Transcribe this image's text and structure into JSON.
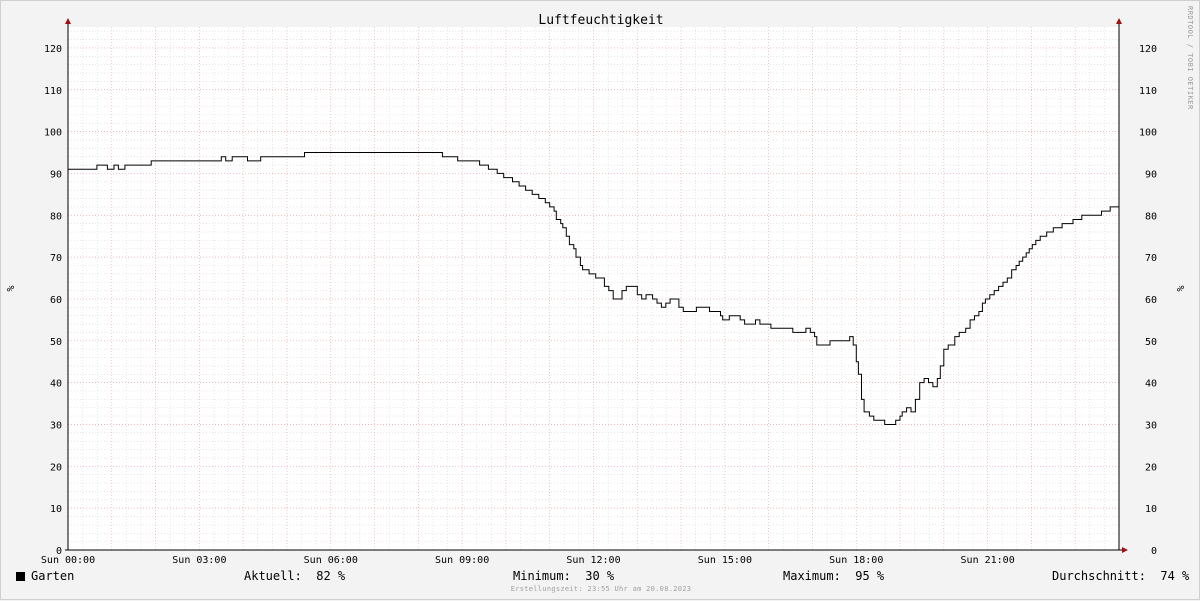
{
  "chart_data": {
    "type": "line",
    "title": "Luftfeuchtigkeit",
    "ylabel": "%",
    "y_right_label": "%",
    "watermark": "RRDTOOL / TOBI OETIKER",
    "ylim": [
      0,
      125
    ],
    "xlim": [
      0,
      24
    ],
    "yticks": [
      0,
      10,
      20,
      30,
      40,
      50,
      60,
      70,
      80,
      90,
      100,
      110,
      120
    ],
    "xticks": [
      {
        "x": 0,
        "label": "Sun 00:00"
      },
      {
        "x": 3,
        "label": "Sun 03:00"
      },
      {
        "x": 6,
        "label": "Sun 06:00"
      },
      {
        "x": 9,
        "label": "Sun 09:00"
      },
      {
        "x": 12,
        "label": "Sun 12:00"
      },
      {
        "x": 15,
        "label": "Sun 15:00"
      },
      {
        "x": 18,
        "label": "Sun 18:00"
      },
      {
        "x": 21,
        "label": "Sun 21:00"
      }
    ],
    "grid": true,
    "series": [
      {
        "name": "Garten",
        "color": "#000000",
        "step": true,
        "points": [
          [
            0.0,
            91
          ],
          [
            0.66,
            92
          ],
          [
            0.9,
            91
          ],
          [
            1.05,
            92
          ],
          [
            1.15,
            91
          ],
          [
            1.3,
            92
          ],
          [
            1.9,
            93
          ],
          [
            3.5,
            94
          ],
          [
            3.6,
            93
          ],
          [
            3.75,
            94
          ],
          [
            4.1,
            93
          ],
          [
            4.4,
            94
          ],
          [
            5.4,
            95
          ],
          [
            8.55,
            94
          ],
          [
            8.9,
            93
          ],
          [
            9.4,
            92
          ],
          [
            9.6,
            91
          ],
          [
            9.8,
            90
          ],
          [
            9.95,
            89
          ],
          [
            10.15,
            88
          ],
          [
            10.3,
            87
          ],
          [
            10.45,
            86
          ],
          [
            10.6,
            85
          ],
          [
            10.75,
            84
          ],
          [
            10.9,
            83
          ],
          [
            11.0,
            82
          ],
          [
            11.1,
            81
          ],
          [
            11.15,
            79
          ],
          [
            11.25,
            78
          ],
          [
            11.3,
            77
          ],
          [
            11.38,
            75
          ],
          [
            11.45,
            73
          ],
          [
            11.55,
            72
          ],
          [
            11.6,
            70
          ],
          [
            11.7,
            68
          ],
          [
            11.75,
            67
          ],
          [
            11.9,
            66
          ],
          [
            12.05,
            65
          ],
          [
            12.25,
            63
          ],
          [
            12.35,
            62
          ],
          [
            12.45,
            60
          ],
          [
            12.65,
            62
          ],
          [
            12.75,
            63
          ],
          [
            13.0,
            61
          ],
          [
            13.1,
            60
          ],
          [
            13.2,
            61
          ],
          [
            13.35,
            60
          ],
          [
            13.45,
            59
          ],
          [
            13.55,
            58
          ],
          [
            13.65,
            59
          ],
          [
            13.75,
            60
          ],
          [
            13.95,
            58
          ],
          [
            14.05,
            57
          ],
          [
            14.35,
            58
          ],
          [
            14.65,
            57
          ],
          [
            14.9,
            56
          ],
          [
            14.95,
            55
          ],
          [
            15.1,
            56
          ],
          [
            15.35,
            55
          ],
          [
            15.45,
            54
          ],
          [
            15.7,
            55
          ],
          [
            15.8,
            54
          ],
          [
            16.05,
            53
          ],
          [
            16.55,
            52
          ],
          [
            16.85,
            53
          ],
          [
            16.95,
            52
          ],
          [
            17.05,
            51
          ],
          [
            17.1,
            49
          ],
          [
            17.4,
            50
          ],
          [
            17.85,
            51
          ],
          [
            17.93,
            49
          ],
          [
            18.0,
            45
          ],
          [
            18.05,
            42
          ],
          [
            18.12,
            36
          ],
          [
            18.18,
            33
          ],
          [
            18.3,
            32
          ],
          [
            18.4,
            31
          ],
          [
            18.65,
            30
          ],
          [
            18.9,
            31
          ],
          [
            19.0,
            32
          ],
          [
            19.05,
            33
          ],
          [
            19.15,
            34
          ],
          [
            19.25,
            33
          ],
          [
            19.35,
            36
          ],
          [
            19.45,
            40
          ],
          [
            19.55,
            41
          ],
          [
            19.65,
            40
          ],
          [
            19.75,
            39
          ],
          [
            19.85,
            41
          ],
          [
            19.92,
            44
          ],
          [
            20.0,
            48
          ],
          [
            20.1,
            49
          ],
          [
            20.25,
            51
          ],
          [
            20.35,
            52
          ],
          [
            20.5,
            53
          ],
          [
            20.6,
            55
          ],
          [
            20.7,
            56
          ],
          [
            20.8,
            57
          ],
          [
            20.88,
            59
          ],
          [
            20.95,
            60
          ],
          [
            21.05,
            61
          ],
          [
            21.15,
            62
          ],
          [
            21.25,
            63
          ],
          [
            21.35,
            64
          ],
          [
            21.45,
            65
          ],
          [
            21.55,
            67
          ],
          [
            21.65,
            68
          ],
          [
            21.72,
            69
          ],
          [
            21.8,
            70
          ],
          [
            21.88,
            71
          ],
          [
            21.95,
            72
          ],
          [
            22.02,
            73
          ],
          [
            22.1,
            74
          ],
          [
            22.2,
            75
          ],
          [
            22.35,
            76
          ],
          [
            22.5,
            77
          ],
          [
            22.7,
            78
          ],
          [
            22.95,
            79
          ],
          [
            23.15,
            80
          ],
          [
            23.6,
            81
          ],
          [
            23.8,
            82
          ],
          [
            24.0,
            82
          ]
        ]
      }
    ]
  },
  "legend": {
    "series_name": "Garten",
    "current_label": "Aktuell:",
    "current_value": "82 %",
    "min_label": "Minimum:",
    "min_value": "30 %",
    "max_label": "Maximum:",
    "max_value": "95 %",
    "avg_label": "Durchschnitt:",
    "avg_value": "74 %"
  },
  "footer": "Erstellungszeit: 23:55 Uhr am 20.08.2023"
}
